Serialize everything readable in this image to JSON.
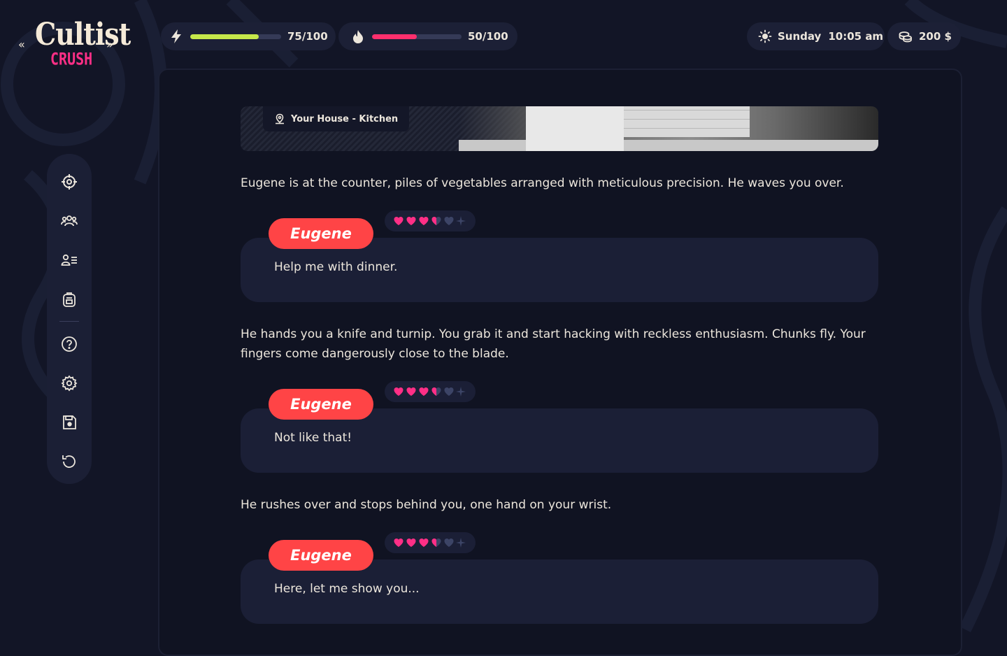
{
  "app": {
    "logo_top": "Cultist",
    "logo_bottom": "CRUSH"
  },
  "hud": {
    "energy": {
      "icon": "lightning-icon",
      "value": 75,
      "max": 100,
      "label": "75/100",
      "color": "#c6e84a"
    },
    "passion": {
      "icon": "flame-icon",
      "value": 50,
      "max": 100,
      "label": "50/100",
      "color": "#ff2f6d"
    },
    "day": "Sunday",
    "time": "10:05 am",
    "money": "200 $"
  },
  "sidebar": {
    "items": [
      {
        "name": "map",
        "icon": "crosshair-icon"
      },
      {
        "name": "characters",
        "icon": "group-icon"
      },
      {
        "name": "profile",
        "icon": "profile-list-icon"
      },
      {
        "name": "inventory",
        "icon": "backpack-icon"
      },
      {
        "name": "help",
        "icon": "question-icon"
      },
      {
        "name": "settings",
        "icon": "gear-icon"
      },
      {
        "name": "save",
        "icon": "save-icon"
      },
      {
        "name": "restart",
        "icon": "restart-icon"
      }
    ]
  },
  "location": {
    "label": "Your House - Kitchen",
    "icon": "location-pin-icon"
  },
  "story": {
    "narration": [
      "Eugene is at the counter, piles of vegetables arranged with meticulous precision. He waves you over.",
      "He hands you a knife and turnip. You grab it and start hacking with reckless enthusiasm. Chunks fly. Your fingers come dangerously close to the blade.",
      "He rushes over and stops behind you, one hand on your wrist."
    ],
    "dialogue": [
      {
        "speaker": "Eugene",
        "text": "Help me with dinner.",
        "affection": 3.5,
        "max_hearts": 5
      },
      {
        "speaker": "Eugene",
        "text": "Not like that!",
        "affection": 3.5,
        "max_hearts": 5
      },
      {
        "speaker": "Eugene",
        "text": "Here, let me show you...",
        "affection": 3.5,
        "max_hearts": 5
      }
    ]
  },
  "colors": {
    "background": "#121526",
    "panel": "#101322",
    "bubble": "#1b1f36",
    "name_tag": "#ff4446",
    "heart": "#ff2f86",
    "heart_empty": "#3c4466"
  }
}
